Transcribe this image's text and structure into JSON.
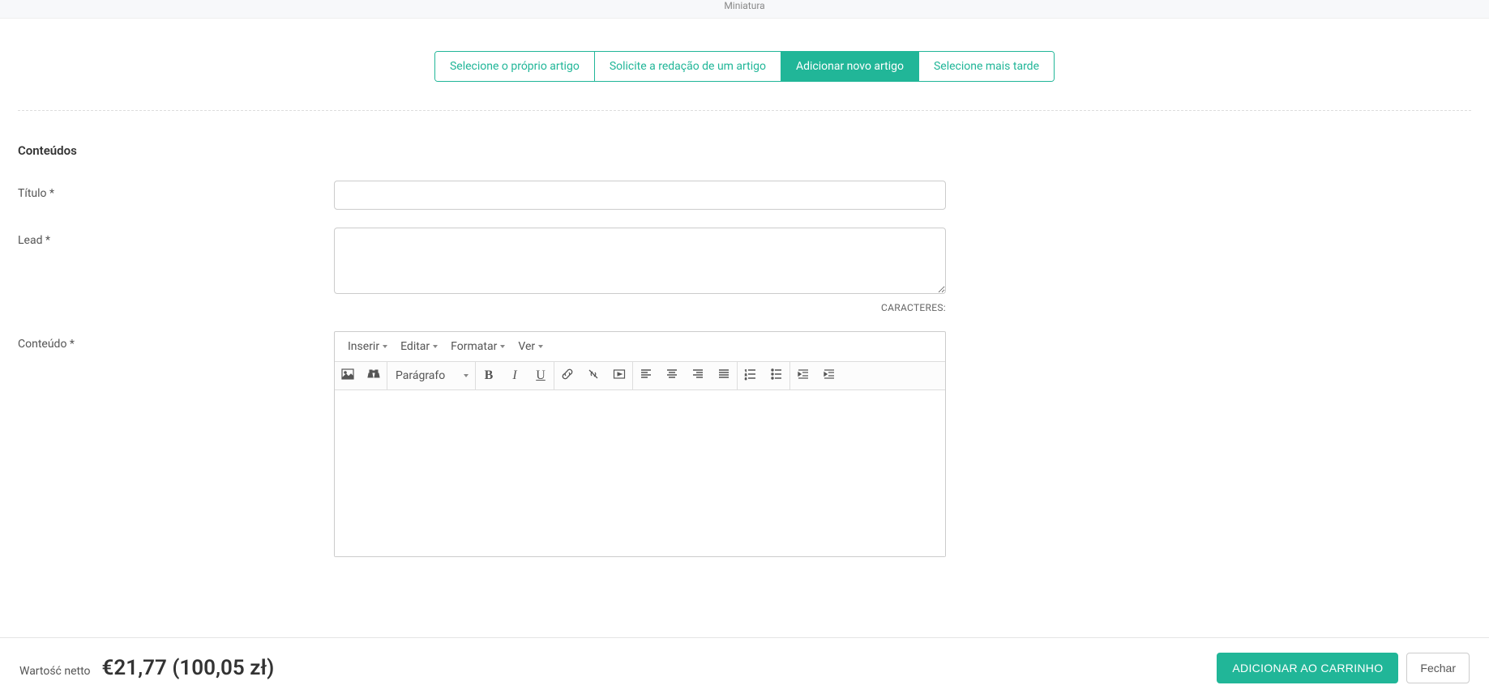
{
  "topbar": {
    "thumbnail_label": "Miniatura"
  },
  "tabs": [
    {
      "label": "Selecione o próprio artigo"
    },
    {
      "label": "Solicite a redação de um artigo"
    },
    {
      "label": "Adicionar novo artigo",
      "active": true
    },
    {
      "label": "Selecione mais tarde"
    }
  ],
  "section": {
    "heading": "Conteúdos"
  },
  "fields": {
    "title_label": "Título *",
    "lead_label": "Lead *",
    "content_label": "Conteúdo *",
    "characters_label": "CARACTERES:"
  },
  "editor": {
    "menus": {
      "insert": "Inserir",
      "edit": "Editar",
      "format": "Formatar",
      "view": "Ver"
    },
    "block_format": "Parágrafo",
    "glyphs": {
      "bold": "B",
      "italic": "I",
      "underline": "U"
    }
  },
  "footer": {
    "net_value_label": "Wartość netto",
    "price": "€21,77 (100,05 zł)",
    "add_to_cart": "ADICIONAR AO CARRINHO",
    "close": "Fechar"
  }
}
